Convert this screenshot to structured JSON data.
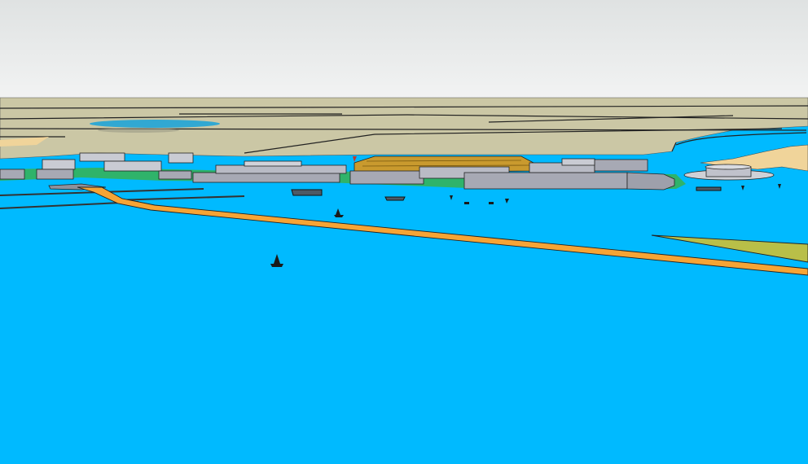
{
  "scene": {
    "description_visible_text": "",
    "colors": {
      "sky_top": "#dfe2e2",
      "sky_bottom": "#f2f3f3",
      "land": "#cbc7a5",
      "water": "#00baff",
      "bridge": "#f6a435",
      "building_grey": "#a7a9b4",
      "building_dark": "#8f919c",
      "building_orange": "#c99a2e",
      "green": "#2fb36a",
      "sand": "#f0d49a",
      "wedge": "#b9bf48",
      "outline": "#111111"
    }
  }
}
